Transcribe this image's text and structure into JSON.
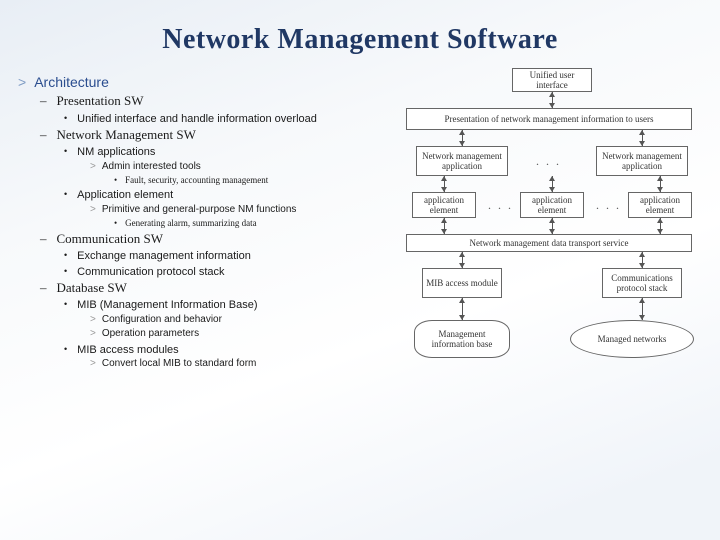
{
  "title": "Network Management Software",
  "outline": {
    "arch": "Architecture",
    "pres": "Presentation SW",
    "pres_b1": "Unified interface and handle information overload",
    "nms": "Network Management SW",
    "nms_b1": "NM applications",
    "nms_b1_s1": "Admin interested tools",
    "nms_b1_s1_t1": "Fault, security, accounting  management",
    "nms_b2": "Application element",
    "nms_b2_s1": "Primitive and general-purpose NM functions",
    "nms_b2_s1_t1": "Generating alarm, summarizing data",
    "comm": "Communication SW",
    "comm_b1": "Exchange management information",
    "comm_b2": "Communication protocol stack",
    "db": "Database SW",
    "db_b1": "MIB (Management Information Base)",
    "db_b1_s1": "Configuration and behavior",
    "db_b1_s2": "Operation parameters",
    "db_b2": "MIB access modules",
    "db_b2_s1": "Convert local MIB to standard form"
  },
  "diagram": {
    "uui": "Unified user interface",
    "pres": "Presentation of network management information to users",
    "app_l": "Network management application",
    "app_r": "Network management application",
    "el_l": "application element",
    "el_m": "application element",
    "el_r": "application element",
    "transport": "Network management data transport service",
    "mib_access": "MIB access module",
    "comm_stack": "Communications protocol stack",
    "mib_store": "Management information base",
    "managed": "Managed networks",
    "ellipsis": ". . ."
  }
}
